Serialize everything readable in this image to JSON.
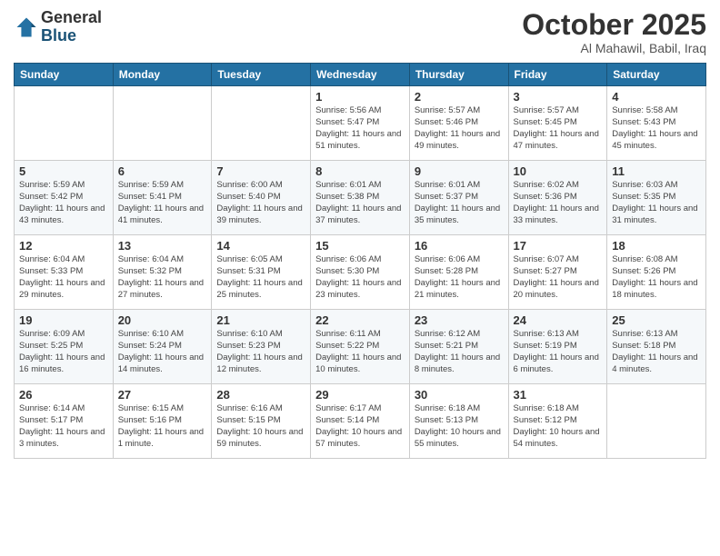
{
  "header": {
    "logo_general": "General",
    "logo_blue": "Blue",
    "month": "October 2025",
    "location": "Al Mahawil, Babil, Iraq"
  },
  "days_of_week": [
    "Sunday",
    "Monday",
    "Tuesday",
    "Wednesday",
    "Thursday",
    "Friday",
    "Saturday"
  ],
  "weeks": [
    [
      {
        "day": "",
        "info": ""
      },
      {
        "day": "",
        "info": ""
      },
      {
        "day": "",
        "info": ""
      },
      {
        "day": "1",
        "info": "Sunrise: 5:56 AM\nSunset: 5:47 PM\nDaylight: 11 hours\nand 51 minutes."
      },
      {
        "day": "2",
        "info": "Sunrise: 5:57 AM\nSunset: 5:46 PM\nDaylight: 11 hours\nand 49 minutes."
      },
      {
        "day": "3",
        "info": "Sunrise: 5:57 AM\nSunset: 5:45 PM\nDaylight: 11 hours\nand 47 minutes."
      },
      {
        "day": "4",
        "info": "Sunrise: 5:58 AM\nSunset: 5:43 PM\nDaylight: 11 hours\nand 45 minutes."
      }
    ],
    [
      {
        "day": "5",
        "info": "Sunrise: 5:59 AM\nSunset: 5:42 PM\nDaylight: 11 hours\nand 43 minutes."
      },
      {
        "day": "6",
        "info": "Sunrise: 5:59 AM\nSunset: 5:41 PM\nDaylight: 11 hours\nand 41 minutes."
      },
      {
        "day": "7",
        "info": "Sunrise: 6:00 AM\nSunset: 5:40 PM\nDaylight: 11 hours\nand 39 minutes."
      },
      {
        "day": "8",
        "info": "Sunrise: 6:01 AM\nSunset: 5:38 PM\nDaylight: 11 hours\nand 37 minutes."
      },
      {
        "day": "9",
        "info": "Sunrise: 6:01 AM\nSunset: 5:37 PM\nDaylight: 11 hours\nand 35 minutes."
      },
      {
        "day": "10",
        "info": "Sunrise: 6:02 AM\nSunset: 5:36 PM\nDaylight: 11 hours\nand 33 minutes."
      },
      {
        "day": "11",
        "info": "Sunrise: 6:03 AM\nSunset: 5:35 PM\nDaylight: 11 hours\nand 31 minutes."
      }
    ],
    [
      {
        "day": "12",
        "info": "Sunrise: 6:04 AM\nSunset: 5:33 PM\nDaylight: 11 hours\nand 29 minutes."
      },
      {
        "day": "13",
        "info": "Sunrise: 6:04 AM\nSunset: 5:32 PM\nDaylight: 11 hours\nand 27 minutes."
      },
      {
        "day": "14",
        "info": "Sunrise: 6:05 AM\nSunset: 5:31 PM\nDaylight: 11 hours\nand 25 minutes."
      },
      {
        "day": "15",
        "info": "Sunrise: 6:06 AM\nSunset: 5:30 PM\nDaylight: 11 hours\nand 23 minutes."
      },
      {
        "day": "16",
        "info": "Sunrise: 6:06 AM\nSunset: 5:28 PM\nDaylight: 11 hours\nand 21 minutes."
      },
      {
        "day": "17",
        "info": "Sunrise: 6:07 AM\nSunset: 5:27 PM\nDaylight: 11 hours\nand 20 minutes."
      },
      {
        "day": "18",
        "info": "Sunrise: 6:08 AM\nSunset: 5:26 PM\nDaylight: 11 hours\nand 18 minutes."
      }
    ],
    [
      {
        "day": "19",
        "info": "Sunrise: 6:09 AM\nSunset: 5:25 PM\nDaylight: 11 hours\nand 16 minutes."
      },
      {
        "day": "20",
        "info": "Sunrise: 6:10 AM\nSunset: 5:24 PM\nDaylight: 11 hours\nand 14 minutes."
      },
      {
        "day": "21",
        "info": "Sunrise: 6:10 AM\nSunset: 5:23 PM\nDaylight: 11 hours\nand 12 minutes."
      },
      {
        "day": "22",
        "info": "Sunrise: 6:11 AM\nSunset: 5:22 PM\nDaylight: 11 hours\nand 10 minutes."
      },
      {
        "day": "23",
        "info": "Sunrise: 6:12 AM\nSunset: 5:21 PM\nDaylight: 11 hours\nand 8 minutes."
      },
      {
        "day": "24",
        "info": "Sunrise: 6:13 AM\nSunset: 5:19 PM\nDaylight: 11 hours\nand 6 minutes."
      },
      {
        "day": "25",
        "info": "Sunrise: 6:13 AM\nSunset: 5:18 PM\nDaylight: 11 hours\nand 4 minutes."
      }
    ],
    [
      {
        "day": "26",
        "info": "Sunrise: 6:14 AM\nSunset: 5:17 PM\nDaylight: 11 hours\nand 3 minutes."
      },
      {
        "day": "27",
        "info": "Sunrise: 6:15 AM\nSunset: 5:16 PM\nDaylight: 11 hours\nand 1 minute."
      },
      {
        "day": "28",
        "info": "Sunrise: 6:16 AM\nSunset: 5:15 PM\nDaylight: 10 hours\nand 59 minutes."
      },
      {
        "day": "29",
        "info": "Sunrise: 6:17 AM\nSunset: 5:14 PM\nDaylight: 10 hours\nand 57 minutes."
      },
      {
        "day": "30",
        "info": "Sunrise: 6:18 AM\nSunset: 5:13 PM\nDaylight: 10 hours\nand 55 minutes."
      },
      {
        "day": "31",
        "info": "Sunrise: 6:18 AM\nSunset: 5:12 PM\nDaylight: 10 hours\nand 54 minutes."
      },
      {
        "day": "",
        "info": ""
      }
    ]
  ]
}
